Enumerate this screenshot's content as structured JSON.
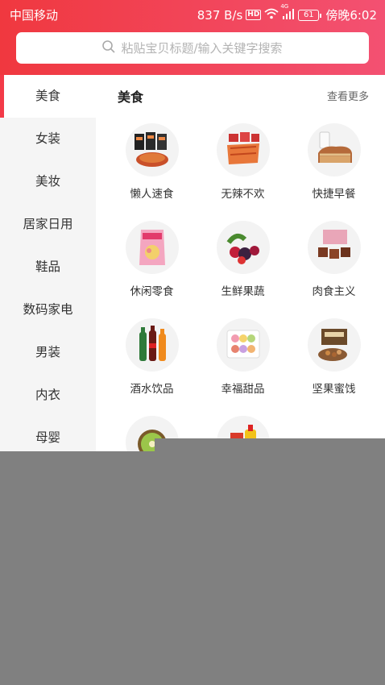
{
  "status_bar": {
    "carrier": "中国移动",
    "speed": "837 B/s",
    "hd_badge": "HD",
    "network": "4G",
    "battery": "61",
    "time": "傍晚6:02"
  },
  "search": {
    "placeholder": "粘贴宝贝标题/输入关键字搜索"
  },
  "sidebar": {
    "items": [
      {
        "label": "美食",
        "active": true
      },
      {
        "label": "女装"
      },
      {
        "label": "美妆"
      },
      {
        "label": "居家日用"
      },
      {
        "label": "鞋品"
      },
      {
        "label": "数码家电"
      },
      {
        "label": "男装"
      },
      {
        "label": "内衣"
      },
      {
        "label": "母婴"
      }
    ]
  },
  "section": {
    "title": "美食",
    "more": "查看更多"
  },
  "categories": [
    {
      "label": "懒人速食",
      "icon": "instant-noodles-icon"
    },
    {
      "label": "无辣不欢",
      "icon": "spicy-jerky-icon"
    },
    {
      "label": "快捷早餐",
      "icon": "bread-milk-icon"
    },
    {
      "label": "休闲零食",
      "icon": "chips-bag-icon"
    },
    {
      "label": "生鲜果蔬",
      "icon": "berries-icon"
    },
    {
      "label": "肉食主义",
      "icon": "beef-jerky-icon"
    },
    {
      "label": "酒水饮品",
      "icon": "drink-bottles-icon"
    },
    {
      "label": "幸福甜品",
      "icon": "macarons-icon"
    },
    {
      "label": "坚果蜜饯",
      "icon": "nuts-box-icon"
    },
    {
      "label": "",
      "icon": "kiwi-fruit-icon"
    },
    {
      "label": "",
      "icon": "cooking-oil-icon"
    }
  ],
  "colors": {
    "accent": "#f33a48",
    "overlay": "#808080"
  }
}
